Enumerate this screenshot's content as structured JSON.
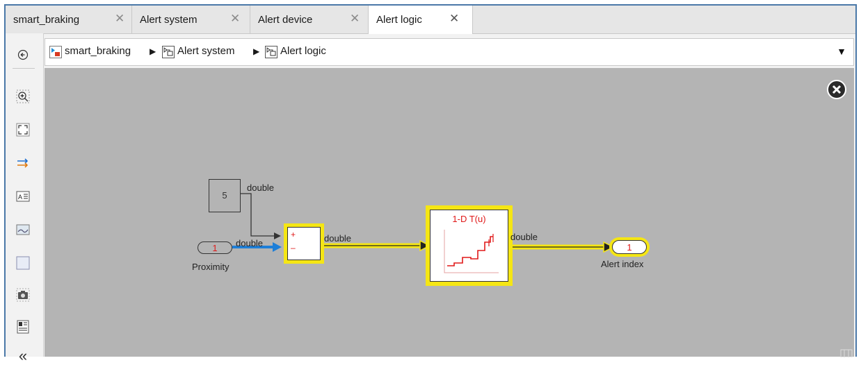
{
  "tabs": [
    {
      "label": "smart_braking",
      "active": false
    },
    {
      "label": "Alert system",
      "active": false
    },
    {
      "label": "Alert device",
      "active": false
    },
    {
      "label": "Alert logic",
      "active": true
    }
  ],
  "tab_close_glyph": "✕",
  "breadcrumb": {
    "items": [
      "smart_braking",
      "Alert system",
      "Alert logic"
    ],
    "separator": "▶",
    "dropdown_glyph": "▼"
  },
  "toolstrip": {
    "icons": [
      "back-icon",
      "zoom-in-icon",
      "fit-to-view-icon",
      "signal-lines-icon",
      "annotation-icon",
      "image-icon",
      "area-icon",
      "screenshot-icon",
      "properties-icon",
      "collapse-icon"
    ],
    "collapse_glyph": "«"
  },
  "diagram": {
    "constant_value": "5",
    "inport_number": "1",
    "inport_name": "Proximity",
    "sum_signs": [
      "+",
      "–"
    ],
    "lookup_label": "1-D T(u)",
    "outport_number": "1",
    "outport_name": "Alert index",
    "signal_type": "double",
    "colors": {
      "canvas": "#b4b4b4",
      "highlight": "#f5e614",
      "selected_signal": "#1e7fd8",
      "block_text_red": "#e01818"
    }
  }
}
